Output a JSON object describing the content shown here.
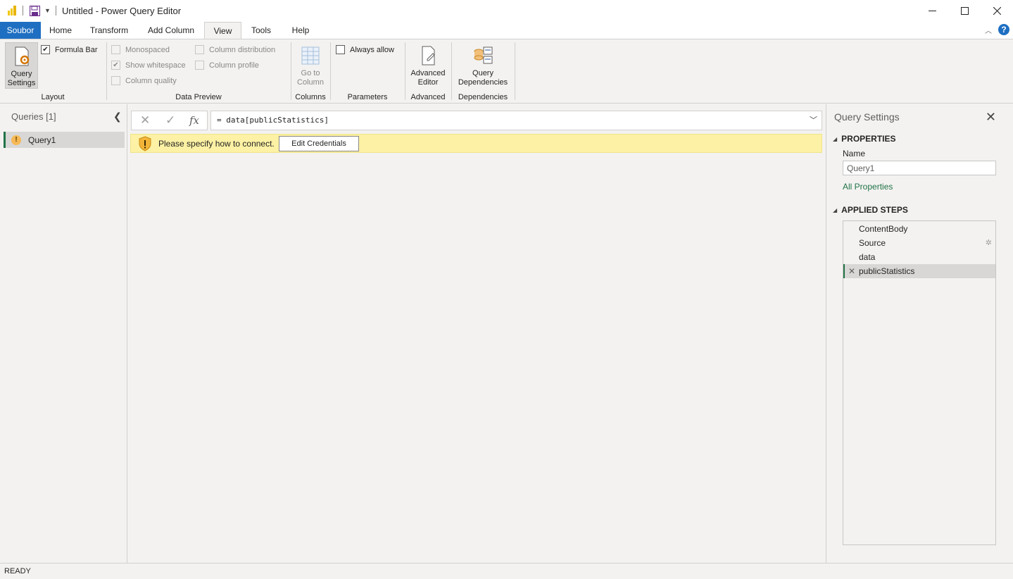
{
  "window": {
    "title": "Untitled - Power Query Editor"
  },
  "tabs": [
    "Soubor",
    "Home",
    "Transform",
    "Add Column",
    "View",
    "Tools",
    "Help"
  ],
  "active_tab": "View",
  "ribbon": {
    "layout": {
      "query_settings": "Query Settings",
      "formula_bar": "Formula Bar",
      "formula_bar_checked": true,
      "label": "Layout"
    },
    "data_preview": {
      "monospaced": "Monospaced",
      "show_whitespace": "Show whitespace",
      "column_quality": "Column quality",
      "column_distribution": "Column distribution",
      "column_profile": "Column profile",
      "label": "Data Preview"
    },
    "columns": {
      "go_to_column": "Go to Column",
      "label": "Columns"
    },
    "parameters": {
      "always_allow": "Always allow",
      "label": "Parameters"
    },
    "advanced": {
      "advanced_editor": "Advanced Editor",
      "label": "Advanced"
    },
    "dependencies": {
      "query_dependencies": "Query Dependencies",
      "label": "Dependencies"
    }
  },
  "queries_pane": {
    "title": "Queries [1]",
    "items": [
      "Query1"
    ]
  },
  "formula_bar": {
    "formula": "= data[publicStatistics]",
    "fx": "fx"
  },
  "banner": {
    "message": "Please specify how to connect.",
    "button": "Edit Credentials"
  },
  "query_settings": {
    "title": "Query Settings",
    "properties_head": "PROPERTIES",
    "name_label": "Name",
    "name_value": "Query1",
    "all_properties": "All Properties",
    "applied_steps_head": "APPLIED STEPS",
    "steps": [
      "ContentBody",
      "Source",
      "data",
      "publicStatistics"
    ],
    "selected_step": "publicStatistics"
  },
  "status": "READY",
  "colors": {
    "accent_blue": "#1e6fc2",
    "accent_green": "#217346",
    "banner_yellow": "#fcf1a4"
  }
}
